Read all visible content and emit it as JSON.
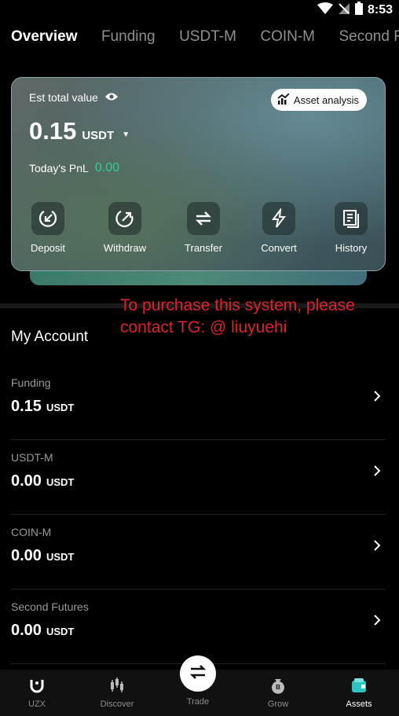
{
  "status_bar": {
    "time": "8:53"
  },
  "tabs": [
    {
      "label": "Overview",
      "active": true
    },
    {
      "label": "Funding"
    },
    {
      "label": "USDT-M"
    },
    {
      "label": "COIN-M"
    },
    {
      "label": "Second Futu"
    }
  ],
  "card": {
    "est_label": "Est total value",
    "analysis_label": "Asset analysis",
    "total_value": "0.15",
    "total_unit": "USDT",
    "pnl_label": "Today's PnL",
    "pnl_value": "0.00",
    "pnl_color": "#2ecf9a",
    "actions": [
      {
        "label": "Deposit",
        "icon": "deposit-icon"
      },
      {
        "label": "Withdraw",
        "icon": "withdraw-icon"
      },
      {
        "label": "Transfer",
        "icon": "transfer-icon"
      },
      {
        "label": "Convert",
        "icon": "convert-icon"
      },
      {
        "label": "History",
        "icon": "history-icon"
      }
    ]
  },
  "promo": {
    "line1": "To purchase this system, please",
    "line2": "contact TG: @ liuyuehi",
    "color": "#e0222c"
  },
  "my_account": {
    "title": "My Account",
    "accounts": [
      {
        "name": "Funding",
        "value": "0.15",
        "unit": "USDT"
      },
      {
        "name": "USDT-M",
        "value": "0.00",
        "unit": "USDT"
      },
      {
        "name": "COIN-M",
        "value": "0.00",
        "unit": "USDT"
      },
      {
        "name": "Second Futures",
        "value": "0.00",
        "unit": "USDT"
      }
    ]
  },
  "bottom_nav": [
    {
      "label": "UZX",
      "icon": "uzx-logo-icon"
    },
    {
      "label": "Discover",
      "icon": "discover-icon"
    },
    {
      "label": "Trade",
      "icon": "trade-swap-icon"
    },
    {
      "label": "Grow",
      "icon": "grow-icon"
    },
    {
      "label": "Assets",
      "icon": "assets-icon",
      "active": true
    }
  ]
}
